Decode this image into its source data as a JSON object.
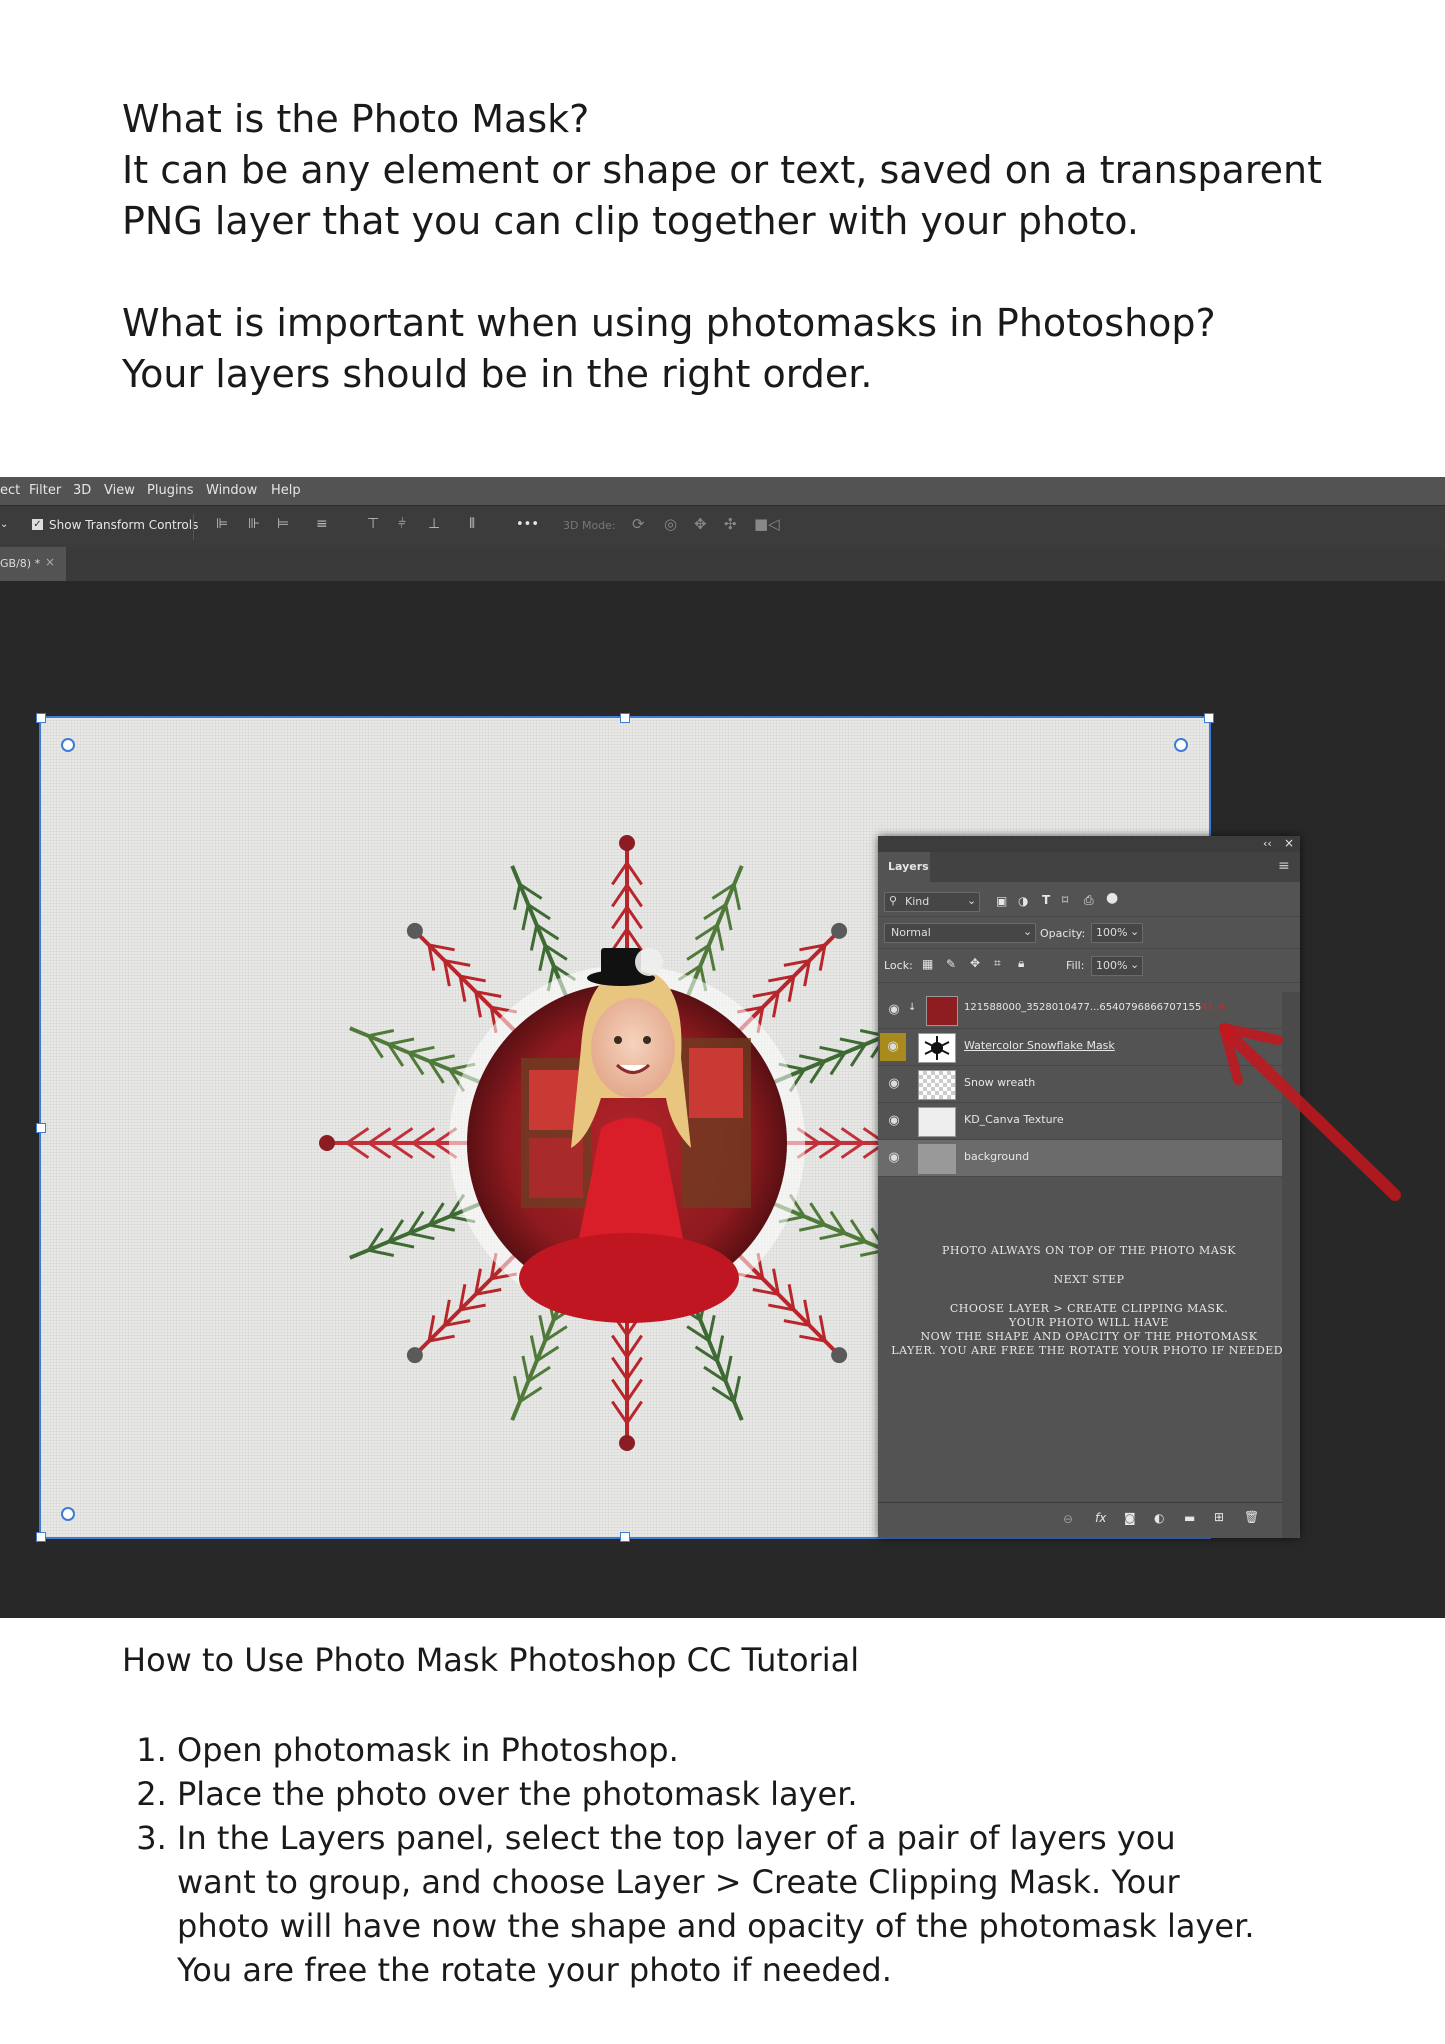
{
  "intro": {
    "q1": "What is the Photo Mask?",
    "a1": "It can be any element or shape or text, saved on a transparent PNG layer that you can clip together with your photo.",
    "q2": "What is important when using photomasks in Photoshop?",
    "a2": "Your layers should be in the right order."
  },
  "photoshop": {
    "menu": [
      "ect",
      "Filter",
      "3D",
      "View",
      "Plugins",
      "Window",
      "Help"
    ],
    "options": {
      "show_transform_controls": "Show Transform Controls",
      "dots": "•••",
      "mode_3d": "3D Mode:"
    },
    "doc_tab": {
      "label": "GB/8) *",
      "close": "×"
    },
    "layers_panel": {
      "tab": "Layers",
      "collapse": "‹‹",
      "close": "×",
      "filter_kind": "Kind",
      "blend_mode": "Normal",
      "opacity_label": "Opacity:",
      "opacity_value": "100%",
      "lock_label": "Lock:",
      "fill_label": "Fill:",
      "fill_value": "100%",
      "layers": [
        {
          "name": "121588000_3528010477...6540796866707155",
          "name_tail": "41_n",
          "visible": true
        },
        {
          "name": "Watercolor Snowflake Mask",
          "visible": true
        },
        {
          "name": "Snow wreath",
          "visible": true
        },
        {
          "name": "KD_Canva Texture",
          "visible": true
        },
        {
          "name": "background",
          "visible": true
        }
      ],
      "notes": [
        "PHOTO ALWAYS ON TOP OF THE PHOTO MASK",
        "NEXT STEP",
        "CHOOSE LAYER > CREATE CLIPPING MASK.",
        "YOUR PHOTO WILL HAVE",
        "NOW THE SHAPE AND OPACITY OF THE PHOTOMASK",
        "LAYER. YOU ARE FREE THE ROTATE YOUR PHOTO IF NEEDED."
      ],
      "footer_icons": [
        "link-icon",
        "fx-icon",
        "mask-icon",
        "adjustment-icon",
        "folder-icon",
        "new-layer-icon",
        "trash-icon"
      ]
    },
    "accent_color": "#3f7bd6",
    "arrow_color": "#c4161c"
  },
  "tutorial": {
    "title": "How to Use Photo Mask Photoshop CC Tutorial",
    "steps": [
      "Open photomask in Photoshop.",
      "Place the photo over the photomask layer.",
      "In the Layers panel, select the top layer of a pair of layers you want to group, and choose Layer > Create Clipping Mask. Your photo will have now the shape and opacity of the photomask layer. You are free the rotate your photo if needed."
    ]
  }
}
